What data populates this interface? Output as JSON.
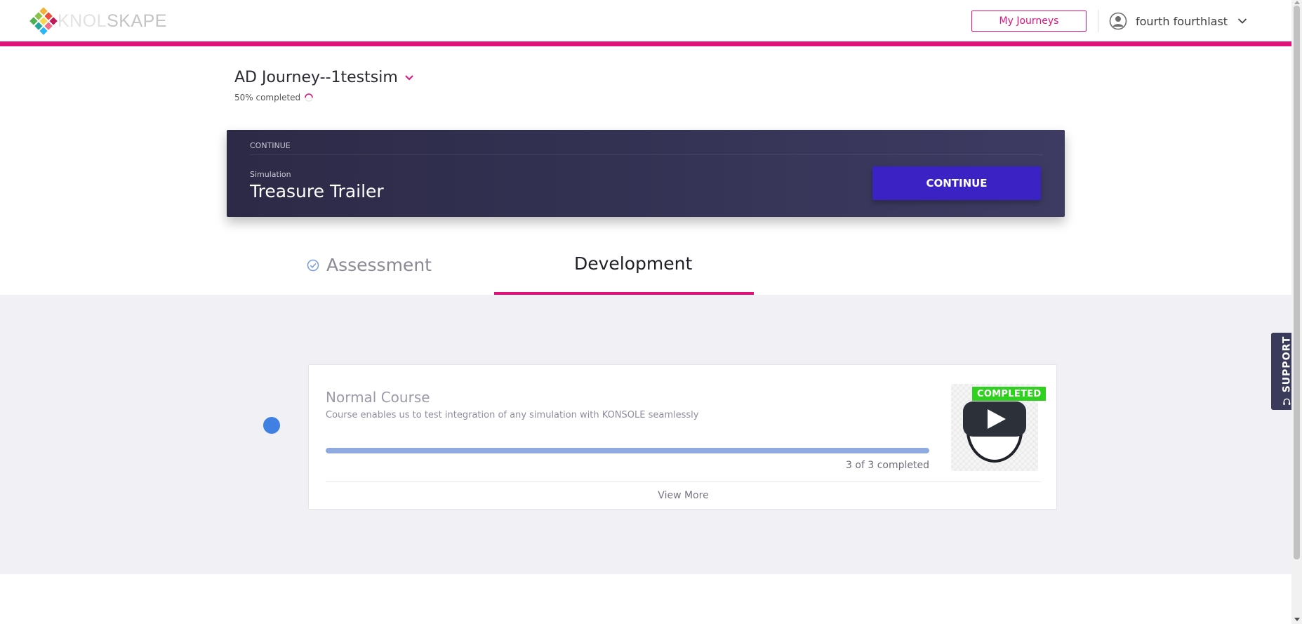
{
  "header": {
    "logo_text_light": "KNOL",
    "logo_text_dark": "SKAPE",
    "my_journeys_label": "My Journeys",
    "user_name": "fourth fourthlast",
    "accent_color": "#e0127a"
  },
  "journey": {
    "title": "AD Journey--1testsim",
    "progress_text": "50% completed",
    "progress_percent": 50
  },
  "continue_banner": {
    "heading": "CONTINUE",
    "item_type": "Simulation",
    "item_name": "Treasure Trailer",
    "button_label": "CONTINUE"
  },
  "tabs": [
    {
      "label": "Assessment",
      "icon": "check-circle-icon",
      "active": false
    },
    {
      "label": "Development",
      "active": true
    }
  ],
  "course": {
    "title": "Normal Course",
    "description": "Course enables us to test integration of any simulation with KONSOLE seamlessly",
    "progress_fraction": 1.0,
    "progress_text": "3 of 3 completed",
    "status_badge": "COMPLETED",
    "view_more_label": "View More",
    "thumbnail_icon": "play-person-icon"
  },
  "support": {
    "label": "SUPPORT",
    "icon": "headset-icon"
  }
}
